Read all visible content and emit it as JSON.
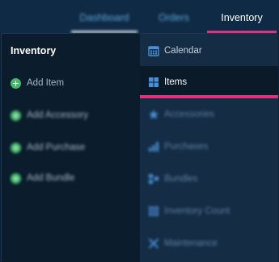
{
  "nav": {
    "tabs": [
      {
        "label": "Dashboard"
      },
      {
        "label": "Orders"
      },
      {
        "label": "Inventory"
      }
    ]
  },
  "dropdown": {
    "title": "Inventory",
    "left_items": [
      {
        "label": "Add Item",
        "icon": "plus-circle-icon"
      },
      {
        "label": "Add Accessory",
        "icon": "plus-circle-icon"
      },
      {
        "label": "Add Purchase",
        "icon": "plus-circle-icon"
      },
      {
        "label": "Add Bundle",
        "icon": "plus-circle-icon"
      }
    ],
    "right_items": [
      {
        "label": "Calendar",
        "icon": "calendar-icon"
      },
      {
        "label": "Items",
        "icon": "grid-icon"
      },
      {
        "label": "Accessories",
        "icon": "star-icon"
      },
      {
        "label": "Purchases",
        "icon": "bar-chart-icon"
      },
      {
        "label": "Bundles",
        "icon": "bundle-icon"
      },
      {
        "label": "Inventory Count",
        "icon": "count-icon"
      },
      {
        "label": "Maintenance",
        "icon": "tools-icon"
      }
    ]
  },
  "colors": {
    "accent": "#e0337f",
    "add_icon": "#43b96a",
    "link_blue": "#5ea3d8"
  }
}
